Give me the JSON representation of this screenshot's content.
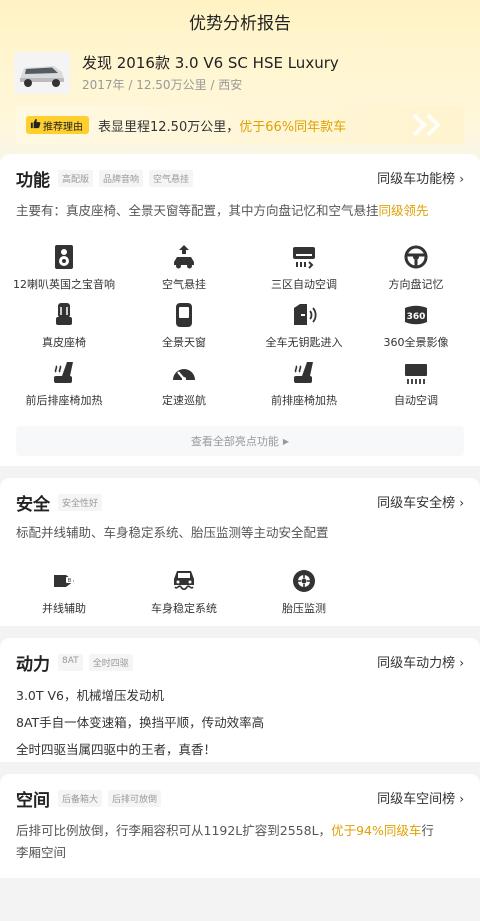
{
  "page_title": "优势分析报告",
  "car": {
    "name": "发现 2016款 3.0 V6 SC HSE Luxury",
    "meta": "2017年 / 12.50万公里 / 西安"
  },
  "reason": {
    "badge": "推荐理由",
    "text_prefix": "表显里程12.50万公里，",
    "text_highlight": "优于66%同年款车"
  },
  "function": {
    "title": "功能",
    "tags": [
      "高配版",
      "品牌音响",
      "空气悬挂"
    ],
    "rank_link": "同级车功能榜",
    "desc_prefix": "主要有：真皮座椅、全景天窗等配置，其中方向盘记忆和空气悬挂",
    "desc_highlight": "同级领先",
    "features": [
      {
        "label": "12喇叭英国之宝音响",
        "icon": "speaker-icon"
      },
      {
        "label": "空气悬挂",
        "icon": "air-suspension-icon"
      },
      {
        "label": "三区自动空调",
        "icon": "climate-zone-icon"
      },
      {
        "label": "方向盘记忆",
        "icon": "steering-wheel-icon"
      },
      {
        "label": "真皮座椅",
        "icon": "leather-seat-icon"
      },
      {
        "label": "全景天窗",
        "icon": "sunroof-icon"
      },
      {
        "label": "全车无钥匙进入",
        "icon": "keyless-entry-icon"
      },
      {
        "label": "360全景影像",
        "icon": "camera-360-icon"
      },
      {
        "label": "前后排座椅加热",
        "icon": "seat-heat-icon"
      },
      {
        "label": "定速巡航",
        "icon": "cruise-control-icon"
      },
      {
        "label": "前排座椅加热",
        "icon": "front-seat-heat-icon"
      },
      {
        "label": "自动空调",
        "icon": "auto-ac-icon"
      }
    ],
    "see_all": "查看全部亮点功能"
  },
  "safety": {
    "title": "安全",
    "tags": [
      "安全性好"
    ],
    "rank_link": "同级车安全榜",
    "desc": "标配并线辅助、车身稳定系统、胎压监测等主动安全配置",
    "features": [
      {
        "label": "并线辅助",
        "icon": "lane-assist-icon"
      },
      {
        "label": "车身稳定系统",
        "icon": "stability-icon"
      },
      {
        "label": "胎压监测",
        "icon": "tire-pressure-icon"
      }
    ]
  },
  "power": {
    "title": "动力",
    "tags": [
      "8AT",
      "全时四驱"
    ],
    "rank_link": "同级车动力榜",
    "lines": [
      "3.0T V6，机械增压发动机",
      "8AT手自一体变速箱，换挡平顺，传动效率高",
      "全时四驱当属四驱中的王者，真香！"
    ]
  },
  "space": {
    "title": "空间",
    "tags": [
      "后备箱大",
      "后排可放倒"
    ],
    "rank_link": "同级车空间榜",
    "desc_prefix": "后排可比例放倒，行李厢容积可从1192L扩容到2558L，",
    "desc_highlight": "优于94%同级车",
    "desc_suffix1": "行",
    "desc_suffix2": "李厢空间"
  },
  "colors": {
    "accent": "#ffcf2e",
    "highlight": "#e0a100"
  }
}
